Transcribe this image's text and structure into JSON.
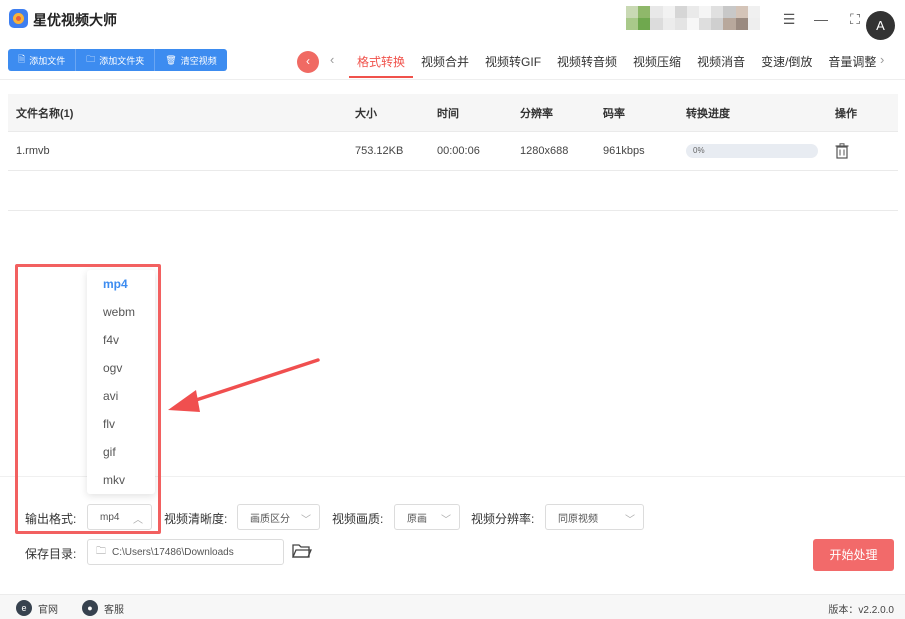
{
  "app": {
    "title": "星优视频大师"
  },
  "toolbar": {
    "buttons": [
      {
        "label": "添加文件",
        "icon": "file-icon"
      },
      {
        "label": "添加文件夹",
        "icon": "folder-icon"
      },
      {
        "label": "清空视频",
        "icon": "trash-icon"
      }
    ]
  },
  "tabs": [
    {
      "label": "格式转换",
      "active": true
    },
    {
      "label": "视频合并"
    },
    {
      "label": "视频转GIF"
    },
    {
      "label": "视频转音频"
    },
    {
      "label": "视频压缩"
    },
    {
      "label": "视频消音"
    },
    {
      "label": "变速/倒放"
    },
    {
      "label": "音量调整"
    }
  ],
  "table": {
    "headers": {
      "name": "文件名称(1)",
      "size": "大小",
      "time": "时间",
      "resolution": "分辨率",
      "bitrate": "码率",
      "progress": "转换进度",
      "action": "操作"
    },
    "rows": [
      {
        "name": "1.rmvb",
        "size": "753.12KB",
        "time": "00:00:06",
        "resolution": "1280x688",
        "bitrate": "961kbps",
        "progress_text": "0%",
        "progress": 0
      }
    ]
  },
  "dropdown": {
    "options": [
      "mp4",
      "webm",
      "f4v",
      "ogv",
      "avi",
      "flv",
      "gif",
      "mkv"
    ],
    "selected": "mp4"
  },
  "settings": {
    "output_format_label": "输出格式:",
    "output_format_value": "mp4",
    "clarity_label": "视频清晰度:",
    "clarity_value": "画质区分",
    "quality_label": "视频画质:",
    "quality_value": "原画",
    "resolution_label": "视频分辨率:",
    "resolution_value": "同原视频",
    "save_dir_label": "保存目录:",
    "save_dir_value": "C:\\Users\\17486\\Downloads",
    "start_label": "开始处理"
  },
  "footer": {
    "website_label": "官网",
    "support_label": "客服",
    "version": "版本：v2.2.0.0"
  },
  "colors": {
    "accent": "#3d8cf0",
    "primary_action": "#f26a6a",
    "active_tab": "#f0524b",
    "highlight_box": "#f26060"
  }
}
